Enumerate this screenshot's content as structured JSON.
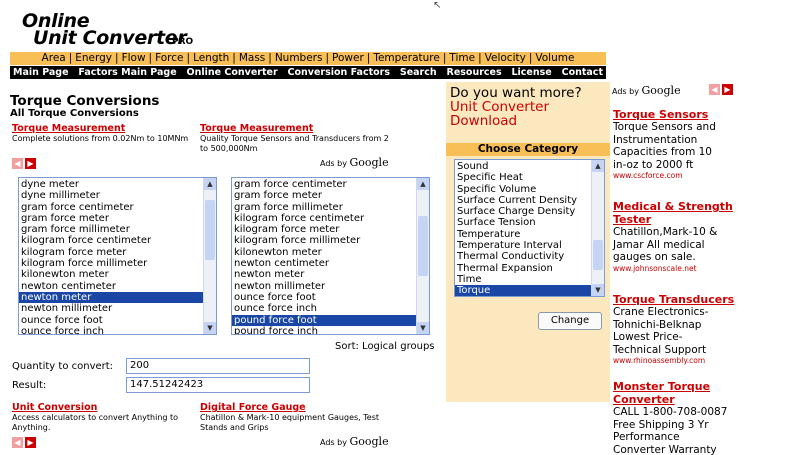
{
  "logo": {
    "line1": "Online",
    "line2": "Unit Converter",
    "badge": "PRO"
  },
  "category_bar": [
    "Area",
    "Energy",
    "Flow",
    "Force",
    "Length",
    "Mass",
    "Numbers",
    "Power",
    "Temperature",
    "Time",
    "Velocity",
    "Volume"
  ],
  "nav": [
    "Main Page",
    "Factors Main Page",
    "Online Converter",
    "Conversion Factors",
    "Search",
    "Resources",
    "License",
    "Contact"
  ],
  "page": {
    "title": "Torque Conversions",
    "subtitle": "All Torque Conversions"
  },
  "top_ads": [
    {
      "title": "Torque Measurement",
      "text": "Complete solutions from 0.02Nm to 10MNm"
    },
    {
      "title": "Torque Measurement",
      "text": "Quality Torque Sensors and Transducers from 2 to 500,000Nm"
    }
  ],
  "bottom_ads": [
    {
      "title": "Unit Conversion",
      "text": "Access calculators to convert Anything to Anything."
    },
    {
      "title": "Digital Force Gauge",
      "text": "Chatillon & Mark-10 equipment Gauges, Test Stands and Grips"
    }
  ],
  "ads_by": {
    "prefix": "Ads by",
    "brand": "Google"
  },
  "from_list": {
    "items": [
      "dyne meter",
      "dyne millimeter",
      "gram force centimeter",
      "gram force meter",
      "gram force millimeter",
      "kilogram force centimeter",
      "kilogram force meter",
      "kilogram force millimeter",
      "kilonewton meter",
      "newton centimeter",
      "newton meter",
      "newton millimeter",
      "ounce force foot",
      "ounce force inch"
    ],
    "selected": "newton meter"
  },
  "to_list": {
    "items": [
      "gram force centimeter",
      "gram force meter",
      "gram force millimeter",
      "kilogram force centimeter",
      "kilogram force meter",
      "kilogram force millimeter",
      "kilonewton meter",
      "newton centimeter",
      "newton meter",
      "newton millimeter",
      "ounce force foot",
      "ounce force inch",
      "pound force foot",
      "pound force inch"
    ],
    "selected": "pound force foot"
  },
  "sort_label": "Sort: Logical groups",
  "quantity": {
    "label": "Quantity to convert:",
    "value": "200"
  },
  "result": {
    "label": "Result:",
    "value": "147.51242423"
  },
  "promo": {
    "question": "Do you want more?",
    "link_line1": "Unit Converter",
    "link_line2": "Download"
  },
  "choose_category": {
    "heading": "Choose Category",
    "items": [
      "Sound",
      "Specific Heat",
      "Specific Volume",
      "Surface Current Density",
      "Surface Charge Density",
      "Surface Tension",
      "Temperature",
      "Temperature Interval",
      "Thermal Conductivity",
      "Thermal Expansion",
      "Time",
      "Torque"
    ],
    "selected": "Torque",
    "button": "Change"
  },
  "right_ads": [
    {
      "title": "Torque Sensors",
      "lines": [
        "Torque Sensors and",
        "Instrumentation",
        "Capacities from 10",
        "in-oz to 2000 ft"
      ],
      "url": "www.cscforce.com"
    },
    {
      "title_lines": [
        "Medical & Strength",
        "Tester"
      ],
      "lines": [
        "Chatillon,Mark-10 &",
        "Jamar All medical",
        "gauges on sale."
      ],
      "url": "www.johnsonscale.net"
    },
    {
      "title": "Torque Transducers",
      "lines": [
        "Crane Electronics-",
        "Tohnichi-Belknap",
        "Lowest Price-",
        "Technical Support"
      ],
      "url": "www.rhinoassembly.com"
    },
    {
      "title_lines": [
        "Monster Torque",
        "Converter"
      ],
      "lines": [
        "CALL 1-800-708-0087",
        "Free Shipping 3 Yr",
        "Performance",
        "Converter Warranty"
      ]
    }
  ],
  "colors": {
    "accent_orange": "#f8bf57",
    "promo_bg": "#fce8bf",
    "link_red": "#cc0000",
    "selection_blue": "#1a47a6"
  }
}
